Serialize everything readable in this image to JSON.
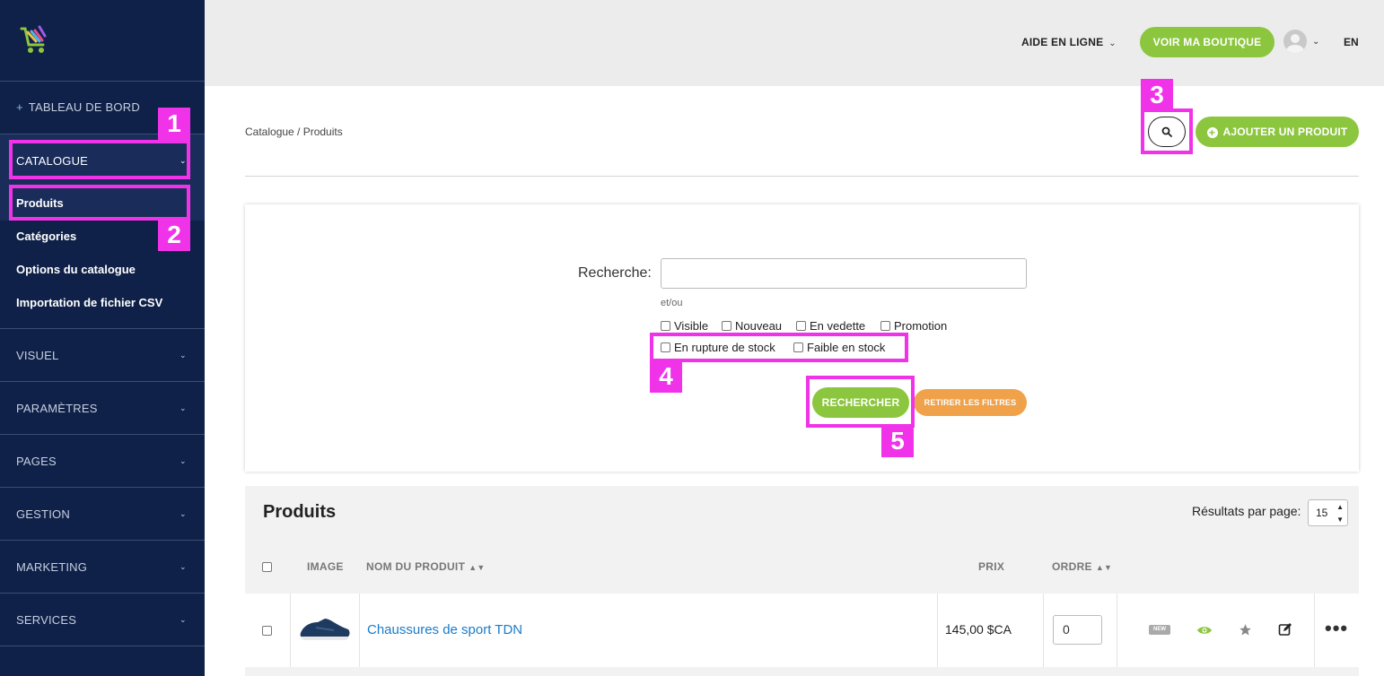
{
  "sidebar": {
    "dashboard": "TABLEAU DE BORD",
    "sections": [
      {
        "label": "CATALOGUE"
      },
      {
        "label": "VISUEL"
      },
      {
        "label": "PARAMÈTRES"
      },
      {
        "label": "PAGES"
      },
      {
        "label": "GESTION"
      },
      {
        "label": "MARKETING"
      },
      {
        "label": "SERVICES"
      }
    ],
    "catalogue_items": [
      "Produits",
      "Catégories",
      "Options du catalogue",
      "Importation de fichier CSV"
    ]
  },
  "topbar": {
    "help": "AIDE EN LIGNE",
    "shop_button": "VOIR MA BOUTIQUE",
    "language": "EN"
  },
  "content": {
    "breadcrumb": "Catalogue / Produits",
    "add_button": "AJOUTER UN PRODUIT"
  },
  "search_panel": {
    "label": "Recherche:",
    "input_value": "",
    "andor": "et/ou",
    "filters": [
      "Visible",
      "Nouveau",
      "En vedette",
      "Promotion",
      "En rupture de stock",
      "Faible en stock"
    ],
    "search_button": "RECHERCHER",
    "clear_button": "RETIRER LES FILTRES"
  },
  "annotations": [
    "1",
    "2",
    "3",
    "4",
    "5"
  ],
  "products": {
    "title": "Produits",
    "per_page_label": "Résultats par page:",
    "per_page_value": "15",
    "columns": {
      "image": "IMAGE",
      "name": "NOM DU PRODUIT",
      "price": "PRIX",
      "order": "ORDRE"
    },
    "rows": [
      {
        "name": "Chaussures de sport TDN",
        "price": "145,00 $CA",
        "order": "0",
        "badge": "NEW"
      }
    ]
  },
  "colors": {
    "sidebar_bg": "#0f2148",
    "accent_green": "#8cc63f",
    "accent_orange": "#f0a24a",
    "highlight": "#f033e8",
    "link_blue": "#1a7bc9"
  }
}
